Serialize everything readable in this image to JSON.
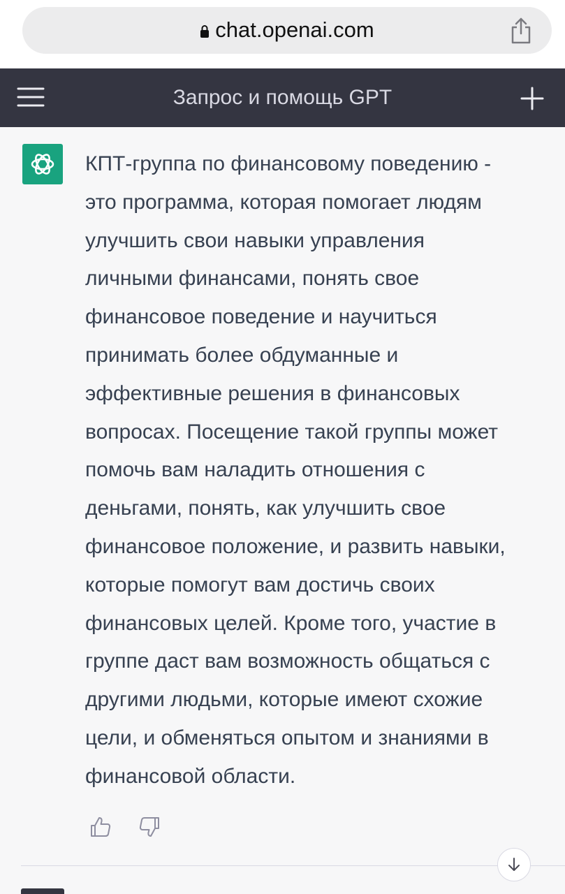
{
  "browser": {
    "url": "chat.openai.com",
    "share_icon": "share-icon",
    "lock_icon": "lock-icon"
  },
  "header": {
    "title": "Запрос и помощь GPT",
    "menu_icon": "hamburger-menu-icon",
    "new_chat_icon": "plus-icon",
    "background": "#343541"
  },
  "message": {
    "author_avatar": "openai-logo-icon",
    "avatar_color": "#19a37f",
    "text": "КПТ-группа по финансовому поведению -\nэто программа, которая помогает людям\nулучшить свои навыки управления\nличными финансами, понять свое\nфинансовое поведение и научиться\nпринимать более обдуманные и\nэффективные решения в финансовых\nвопросах. Посещение такой группы может\nпомочь вам наладить отношения с\nденьгами, понять, как улучшить свое\nфинансовое положение, и развить навыки,\nкоторые помогут вам достичь своих\nфинансовых целей. Кроме того, участие в\nгруппе даст вам возможность общаться с\nдругими людьми, которые имеют схожие\nцели, и обменяться опытом и знаниями в\nфинансовой области.",
    "feedback_icons": [
      "thumbs-up-icon",
      "thumbs-down-icon"
    ]
  },
  "controls": {
    "scroll_down_icon": "arrow-down-icon"
  }
}
